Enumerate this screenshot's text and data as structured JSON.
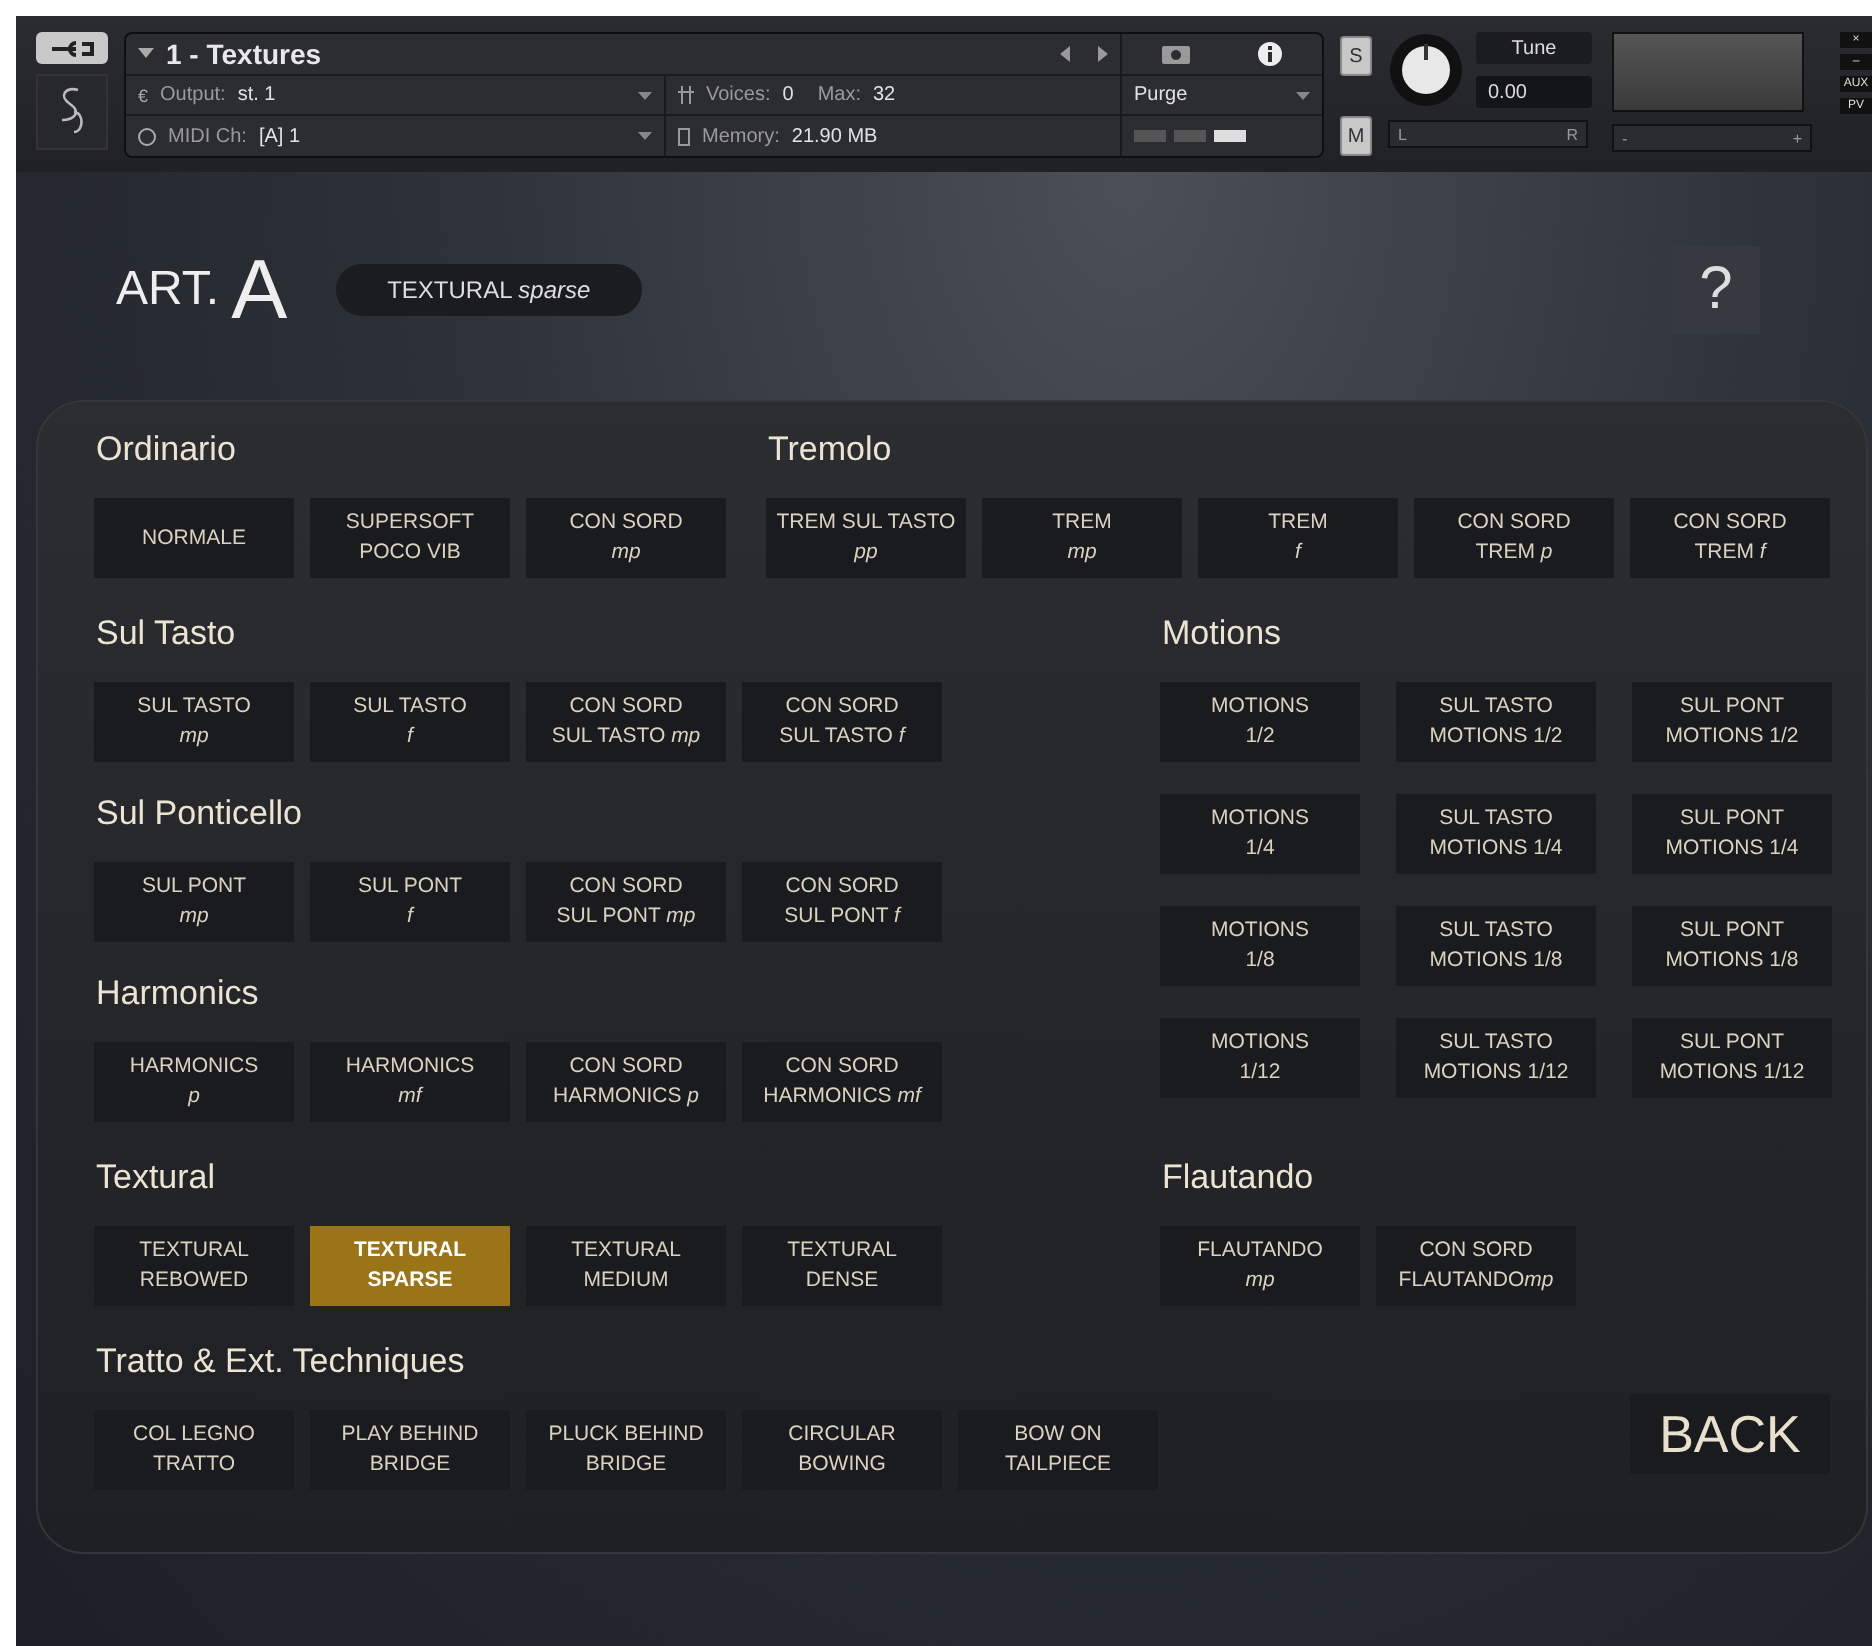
{
  "header": {
    "title": "1 - Textures",
    "output_icon": "€",
    "output_label": "Output:",
    "output_value": "st. 1",
    "voices_label": "Voices:",
    "voices_value": "0",
    "max_label": "Max:",
    "max_value": "32",
    "midi_label": "MIDI Ch:",
    "midi_value": "[A] 1",
    "memory_label": "Memory:",
    "memory_value": "21.90 MB",
    "purge": "Purge",
    "solo": "S",
    "mute": "M",
    "tune_label": "Tune",
    "tune_value": "0.00",
    "pan_left": "L",
    "pan_right": "R",
    "vol_minus": "-",
    "vol_plus": "+",
    "aux": "AUX",
    "pv": "PV",
    "close": "×",
    "minimize": "–"
  },
  "title": {
    "prefix": "ART.",
    "letter": "A",
    "current": "TEXTURAL *sparse*",
    "help": "?"
  },
  "rows": [
    {
      "kind": "wide",
      "left": [
        {
          "title": "Ordinario",
          "kind": "row",
          "buttons": [
            {
              "lines": [
                "NORMALE"
              ],
              "selected": false
            },
            {
              "lines": [
                "SUPERSOFT",
                "POCO VIB"
              ],
              "selected": false
            },
            {
              "lines": [
                "CON SORD",
                [
                  {
                    "text": "mp",
                    "italic": true
                  }
                ]
              ],
              "selected": false
            }
          ]
        },
        {
          "title": "Tremolo",
          "kind": "row",
          "buttons": [
            {
              "lines": [
                "TREM SUL TASTO",
                [
                  {
                    "text": "pp",
                    "italic": true
                  }
                ]
              ],
              "selected": false
            },
            {
              "lines": [
                "TREM",
                [
                  {
                    "text": "mp",
                    "italic": true
                  }
                ]
              ],
              "selected": false
            },
            {
              "lines": [
                "TREM",
                [
                  {
                    "text": "f",
                    "italic": true
                  }
                ]
              ],
              "selected": false
            },
            {
              "lines": [
                "CON SORD",
                [
                  {
                    "text": "TREM ",
                    "italic": false
                  },
                  {
                    "text": "p",
                    "italic": true
                  }
                ]
              ],
              "selected": false
            },
            {
              "lines": [
                "CON SORD",
                [
                  {
                    "text": "TREM ",
                    "italic": false
                  },
                  {
                    "text": "f",
                    "italic": true
                  }
                ]
              ],
              "selected": false
            }
          ]
        }
      ]
    },
    {
      "kind": "split",
      "left": [
        {
          "title": "Sul Tasto",
          "kind": "row",
          "buttons": [
            {
              "lines": [
                "SUL TASTO",
                [
                  {
                    "text": "mp",
                    "italic": true
                  }
                ]
              ],
              "selected": false
            },
            {
              "lines": [
                "SUL TASTO",
                [
                  {
                    "text": "f",
                    "italic": true
                  }
                ]
              ],
              "selected": false
            },
            {
              "lines": [
                "CON SORD",
                [
                  {
                    "text": "SUL TASTO ",
                    "italic": false
                  },
                  {
                    "text": "mp",
                    "italic": true
                  }
                ]
              ],
              "selected": false
            },
            {
              "lines": [
                "CON SORD",
                [
                  {
                    "text": "SUL TASTO ",
                    "italic": false
                  },
                  {
                    "text": "f",
                    "italic": true
                  }
                ]
              ],
              "selected": false
            }
          ]
        },
        {
          "title": "Sul Ponticello",
          "kind": "row",
          "buttons": [
            {
              "lines": [
                "SUL PONT",
                [
                  {
                    "text": "mp",
                    "italic": true
                  }
                ]
              ],
              "selected": false
            },
            {
              "lines": [
                "SUL PONT",
                [
                  {
                    "text": "f",
                    "italic": true
                  }
                ]
              ],
              "selected": false
            },
            {
              "lines": [
                "CON SORD",
                [
                  {
                    "text": "SUL PONT ",
                    "italic": false
                  },
                  {
                    "text": "mp",
                    "italic": true
                  }
                ]
              ],
              "selected": false
            },
            {
              "lines": [
                "CON SORD",
                [
                  {
                    "text": "SUL PONT ",
                    "italic": false
                  },
                  {
                    "text": "f",
                    "italic": true
                  }
                ]
              ],
              "selected": false
            }
          ]
        },
        {
          "title": "Harmonics",
          "kind": "row",
          "buttons": [
            {
              "lines": [
                "HARMONICS",
                [
                  {
                    "text": "p",
                    "italic": true
                  }
                ]
              ],
              "selected": false
            },
            {
              "lines": [
                "HARMONICS",
                [
                  {
                    "text": "mf",
                    "italic": true
                  }
                ]
              ],
              "selected": false
            },
            {
              "lines": [
                "CON SORD",
                [
                  {
                    "text": "HARMONICS ",
                    "italic": false
                  },
                  {
                    "text": "p",
                    "italic": true
                  }
                ]
              ],
              "selected": false
            },
            {
              "lines": [
                "CON SORD",
                [
                  {
                    "text": "HARMONICS ",
                    "italic": false
                  },
                  {
                    "text": "mf",
                    "italic": true
                  }
                ]
              ],
              "selected": false
            }
          ]
        }
      ],
      "right": [
        {
          "title": "Motions",
          "kind": "grid",
          "buttons": [
            {
              "lines": [
                "MOTIONS",
                "1/2"
              ],
              "selected": false
            },
            {
              "lines": [
                "SUL TASTO",
                "MOTIONS 1/2"
              ],
              "selected": false
            },
            {
              "lines": [
                "SUL PONT",
                "MOTIONS 1/2"
              ],
              "selected": false
            },
            {
              "lines": [
                "MOTIONS",
                "1/4"
              ],
              "selected": false
            },
            {
              "lines": [
                "SUL TASTO",
                "MOTIONS 1/4"
              ],
              "selected": false
            },
            {
              "lines": [
                "SUL PONT",
                "MOTIONS 1/4"
              ],
              "selected": false
            },
            {
              "lines": [
                "MOTIONS",
                "1/8"
              ],
              "selected": false
            },
            {
              "lines": [
                "SUL TASTO",
                "MOTIONS 1/8"
              ],
              "selected": false
            },
            {
              "lines": [
                "SUL PONT",
                "MOTIONS 1/8"
              ],
              "selected": false
            },
            {
              "lines": [
                "MOTIONS",
                "1/12"
              ],
              "selected": false
            },
            {
              "lines": [
                "SUL TASTO",
                "MOTIONS 1/12"
              ],
              "selected": false
            },
            {
              "lines": [
                "SUL PONT",
                "MOTIONS 1/12"
              ],
              "selected": false
            }
          ]
        }
      ]
    },
    {
      "kind": "split",
      "left": [
        {
          "title": "Textural",
          "kind": "row",
          "buttons": [
            {
              "lines": [
                "TEXTURAL",
                "REBOWED"
              ],
              "selected": false
            },
            {
              "lines": [
                "TEXTURAL",
                "SPARSE"
              ],
              "selected": true
            },
            {
              "lines": [
                "TEXTURAL",
                "MEDIUM"
              ],
              "selected": false
            },
            {
              "lines": [
                "TEXTURAL",
                "DENSE"
              ],
              "selected": false
            }
          ]
        }
      ],
      "right": [
        {
          "title": "Flautando",
          "kind": "row",
          "buttons": [
            {
              "lines": [
                "FLAUTANDO",
                [
                  {
                    "text": "mp",
                    "italic": true
                  }
                ]
              ],
              "selected": false
            },
            {
              "lines": [
                "CON SORD",
                [
                  {
                    "text": "FLAUTANDO",
                    "italic": false
                  },
                  {
                    "text": "mp",
                    "italic": true
                  }
                ]
              ],
              "selected": false
            }
          ]
        }
      ]
    },
    {
      "kind": "footer",
      "left": [
        {
          "title": "Tratto & Ext. Techniques",
          "kind": "row",
          "buttons": [
            {
              "lines": [
                "COL LEGNO",
                "TRATTO"
              ],
              "selected": false
            },
            {
              "lines": [
                "PLAY BEHIND",
                "BRIDGE"
              ],
              "selected": false
            },
            {
              "lines": [
                "PLUCK BEHIND",
                "BRIDGE"
              ],
              "selected": false
            },
            {
              "lines": [
                "CIRCULAR",
                "BOWING"
              ],
              "selected": false
            },
            {
              "lines": [
                "BOW ON",
                "TAILPIECE"
              ],
              "selected": false
            }
          ]
        }
      ],
      "back": "BACK"
    }
  ]
}
